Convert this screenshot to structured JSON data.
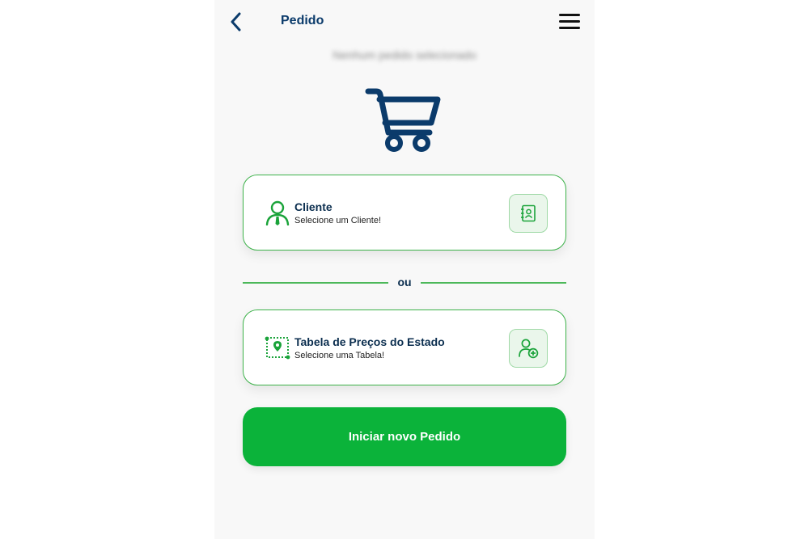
{
  "header": {
    "title": "Pedido",
    "back_icon": "chevron-left-icon",
    "menu_icon": "hamburger-menu-icon"
  },
  "status_text": "Nenhum pedido selecionado",
  "cart_icon": "shopping-cart-icon",
  "client_card": {
    "title": "Cliente",
    "subtitle": "Selecione um Cliente!",
    "icon": "user-tie-icon",
    "action_icon": "contact-book-icon"
  },
  "separator": {
    "text": "ou"
  },
  "table_card": {
    "title": "Tabela de Preços do Estado",
    "subtitle": "Selecione uma Tabela!",
    "icon": "map-route-icon",
    "action_icon": "add-user-icon"
  },
  "primary_button": {
    "label": "Iniciar novo Pedido"
  },
  "colors": {
    "navy": "#0b3b6b",
    "green": "#3db24a",
    "button_green": "#0bb33a",
    "action_bg": "#eaf6eb"
  }
}
